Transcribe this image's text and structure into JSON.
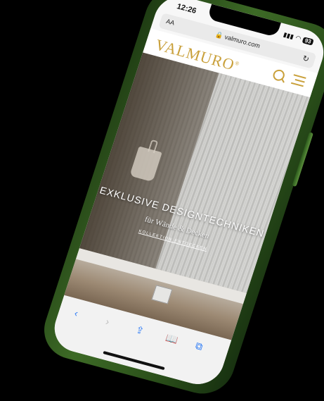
{
  "status": {
    "time": "12:26",
    "battery": "93"
  },
  "browser": {
    "aa_label": "AA",
    "url": "valmuro.com",
    "reload_icon": "reload-icon"
  },
  "site": {
    "logo": "VALMURO",
    "logo_mark": "®",
    "accent_color": "#c9a03a",
    "hero": {
      "title": "EXKLUSIVE DESIGNTECHNIKEN",
      "subtitle": "für Wände & Decken",
      "link": "KOLLEKTION ENTDECKEN"
    }
  },
  "toolbar": {
    "back": "‹",
    "forward": "›",
    "share": "⇪",
    "bookmarks": "📖",
    "tabs": "⧉"
  }
}
